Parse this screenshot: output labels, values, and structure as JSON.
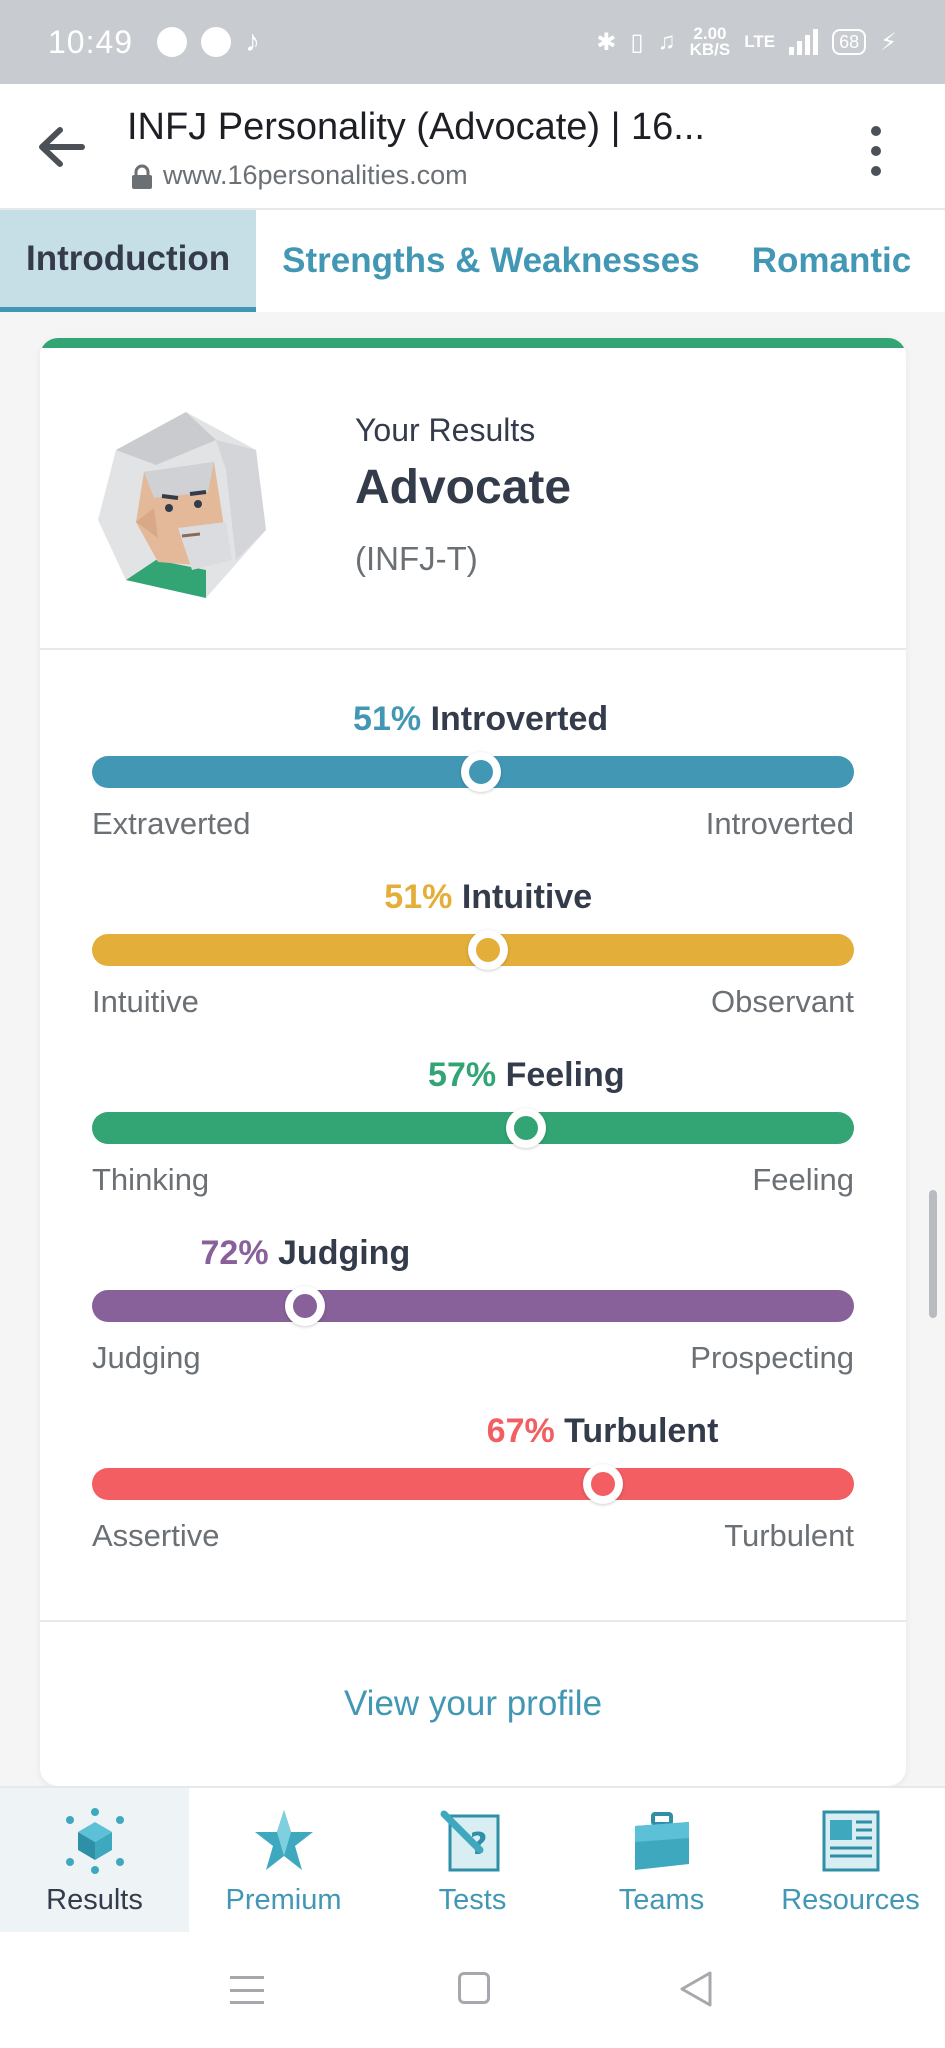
{
  "status_bar": {
    "time": "10:49",
    "speed_value": "2.00",
    "speed_unit": "KB/S",
    "network": "LTE",
    "battery": "68",
    "icons": [
      "spotify-icon",
      "messenger-icon",
      "tiktok-icon",
      "bluetooth-icon",
      "vibrate-icon",
      "mute-icon",
      "signal-icon",
      "charging-icon"
    ]
  },
  "browser": {
    "title": "INFJ Personality (Advocate) | 16...",
    "url": "www.16personalities.com"
  },
  "tabs": [
    {
      "label": "Introduction",
      "active": true
    },
    {
      "label": "Strengths & Weaknesses",
      "active": false
    },
    {
      "label": "Romantic",
      "active": false
    }
  ],
  "results": {
    "heading": "Your Results",
    "type_name": "Advocate",
    "type_code": "(INFJ-T)"
  },
  "traits": [
    {
      "percent": "51%",
      "trait": "Introverted",
      "left": "Extraverted",
      "right": "Introverted",
      "position": 0.51,
      "color": "#4298b4"
    },
    {
      "percent": "51%",
      "trait": "Intuitive",
      "left": "Intuitive",
      "right": "Observant",
      "position": 0.52,
      "color": "#e4ae3a"
    },
    {
      "percent": "57%",
      "trait": "Feeling",
      "left": "Thinking",
      "right": "Feeling",
      "position": 0.57,
      "color": "#33a474"
    },
    {
      "percent": "72%",
      "trait": "Judging",
      "left": "Judging",
      "right": "Prospecting",
      "position": 0.28,
      "color": "#88619a"
    },
    {
      "percent": "67%",
      "trait": "Turbulent",
      "left": "Assertive",
      "right": "Turbulent",
      "position": 0.67,
      "color": "#f25e62"
    }
  ],
  "profile_link": "View your profile",
  "bottom_nav": [
    {
      "label": "Results",
      "icon": "results-icon",
      "active": true
    },
    {
      "label": "Premium",
      "icon": "premium-icon",
      "active": false
    },
    {
      "label": "Tests",
      "icon": "tests-icon",
      "active": false
    },
    {
      "label": "Teams",
      "icon": "teams-icon",
      "active": false
    },
    {
      "label": "Resources",
      "icon": "resources-icon",
      "active": false
    }
  ]
}
